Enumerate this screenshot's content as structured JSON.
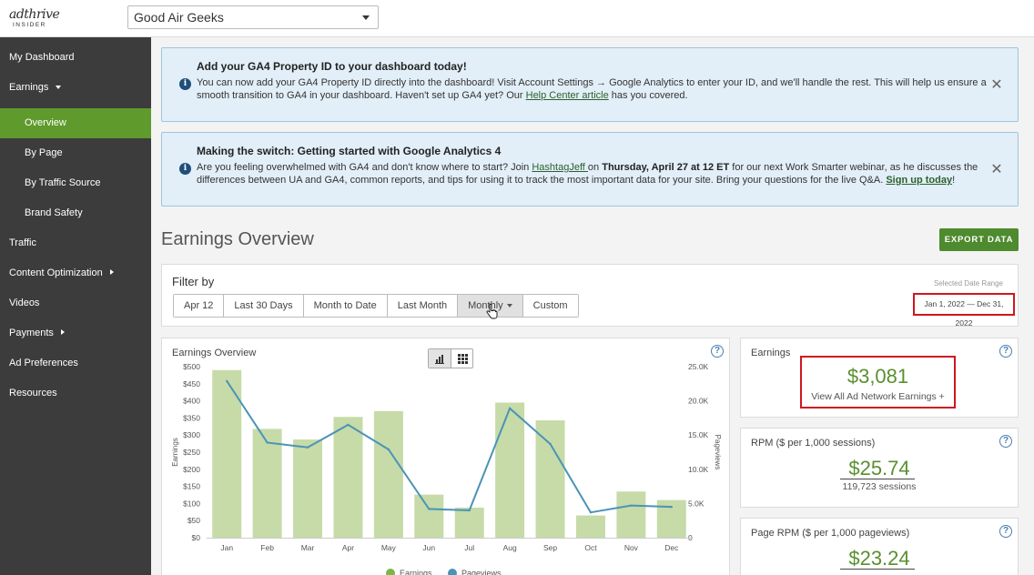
{
  "header": {
    "logo_main": "adthrive",
    "logo_sub": "INSIDER",
    "site_selected": "Good Air Geeks"
  },
  "sidebar": {
    "items": [
      {
        "label": "My Dashboard"
      },
      {
        "label": "Earnings"
      },
      {
        "label": "Overview"
      },
      {
        "label": "By Page"
      },
      {
        "label": "By Traffic Source"
      },
      {
        "label": "Brand Safety"
      },
      {
        "label": "Traffic"
      },
      {
        "label": "Content Optimization"
      },
      {
        "label": "Videos"
      },
      {
        "label": "Payments"
      },
      {
        "label": "Ad Preferences"
      },
      {
        "label": "Resources"
      }
    ]
  },
  "banner1": {
    "title": "Add your GA4 Property ID to your dashboard today!",
    "text_a": "You can now add your GA4 Property ID directly into the dashboard! Visit Account Settings → Google Analytics to enter your ID, and we'll handle the rest. This will help us ensure a smooth transition to GA4 in your dashboard. Haven't set up GA4 yet? Our ",
    "link": "Help Center article",
    "text_b": " has you covered."
  },
  "banner2": {
    "title": "Making the switch: Getting started with Google Analytics 4",
    "text_a": "Are you feeling overwhelmed with GA4 and don't know where to start? Join ",
    "link1": "HashtagJeff ",
    "text_b": "on ",
    "bold": "Thursday, April 27 at 12 ET",
    "text_c": " for our next Work Smarter webinar, as he discusses the differences between UA and GA4, common reports, and tips for using it to track the most important data for your site. Bring your questions for the live Q&A. ",
    "link2": "Sign up today",
    "text_d": "!"
  },
  "page": {
    "title": "Earnings Overview",
    "export_label": "EXPORT DATA"
  },
  "filter": {
    "label": "Filter by",
    "buttons": [
      "Apr 12",
      "Last 30 Days",
      "Month to Date",
      "Last Month",
      "Monthly",
      "Custom"
    ],
    "selected": "Monthly",
    "range_label": "Selected Date Range",
    "range_value": "Jan 1, 2022 — Dec 31, 2022"
  },
  "chart_data": {
    "type": "bar",
    "title": "Earnings Overview",
    "categories": [
      "Jan",
      "Feb",
      "Mar",
      "Apr",
      "May",
      "Jun",
      "Jul",
      "Aug",
      "Sep",
      "Oct",
      "Nov",
      "Dec"
    ],
    "series": [
      {
        "name": "Earnings",
        "type": "bar",
        "axis": "left",
        "color": "#c6dba8",
        "values": [
          490,
          318,
          287,
          353,
          370,
          126,
          88,
          395,
          343,
          65,
          135,
          110
        ]
      },
      {
        "name": "Pageviews",
        "type": "line",
        "axis": "right",
        "color": "#4b93b7",
        "values": [
          22900,
          13900,
          13200,
          16500,
          12900,
          4200,
          4000,
          18900,
          13700,
          3700,
          4700,
          4500
        ]
      }
    ],
    "ylabel": "Earnings",
    "y2label": "Pageviews",
    "ylim": [
      0,
      500
    ],
    "y2lim": [
      0,
      25000
    ],
    "yticks": [
      "$0",
      "$50",
      "$100",
      "$150",
      "$200",
      "$250",
      "$300",
      "$350",
      "$400",
      "$450",
      "$500"
    ],
    "y2ticks": [
      "0",
      "5.0K",
      "10.0K",
      "15.0K",
      "20.0K",
      "25.0K"
    ],
    "legend": [
      "Earnings",
      "Pageviews"
    ]
  },
  "cards": {
    "earnings": {
      "title": "Earnings",
      "value": "$3,081",
      "link": "View All Ad Network Earnings +"
    },
    "rpm": {
      "title": "RPM ($ per 1,000 sessions)",
      "value": "$25.74",
      "sub": "119,723 sessions"
    },
    "page_rpm": {
      "title": "Page RPM ($ per 1,000 pageviews)",
      "value": "$23.24"
    }
  },
  "colors": {
    "accent": "#5f9a2c",
    "highlight": "#d0161f",
    "info": "#1f4f7a"
  }
}
